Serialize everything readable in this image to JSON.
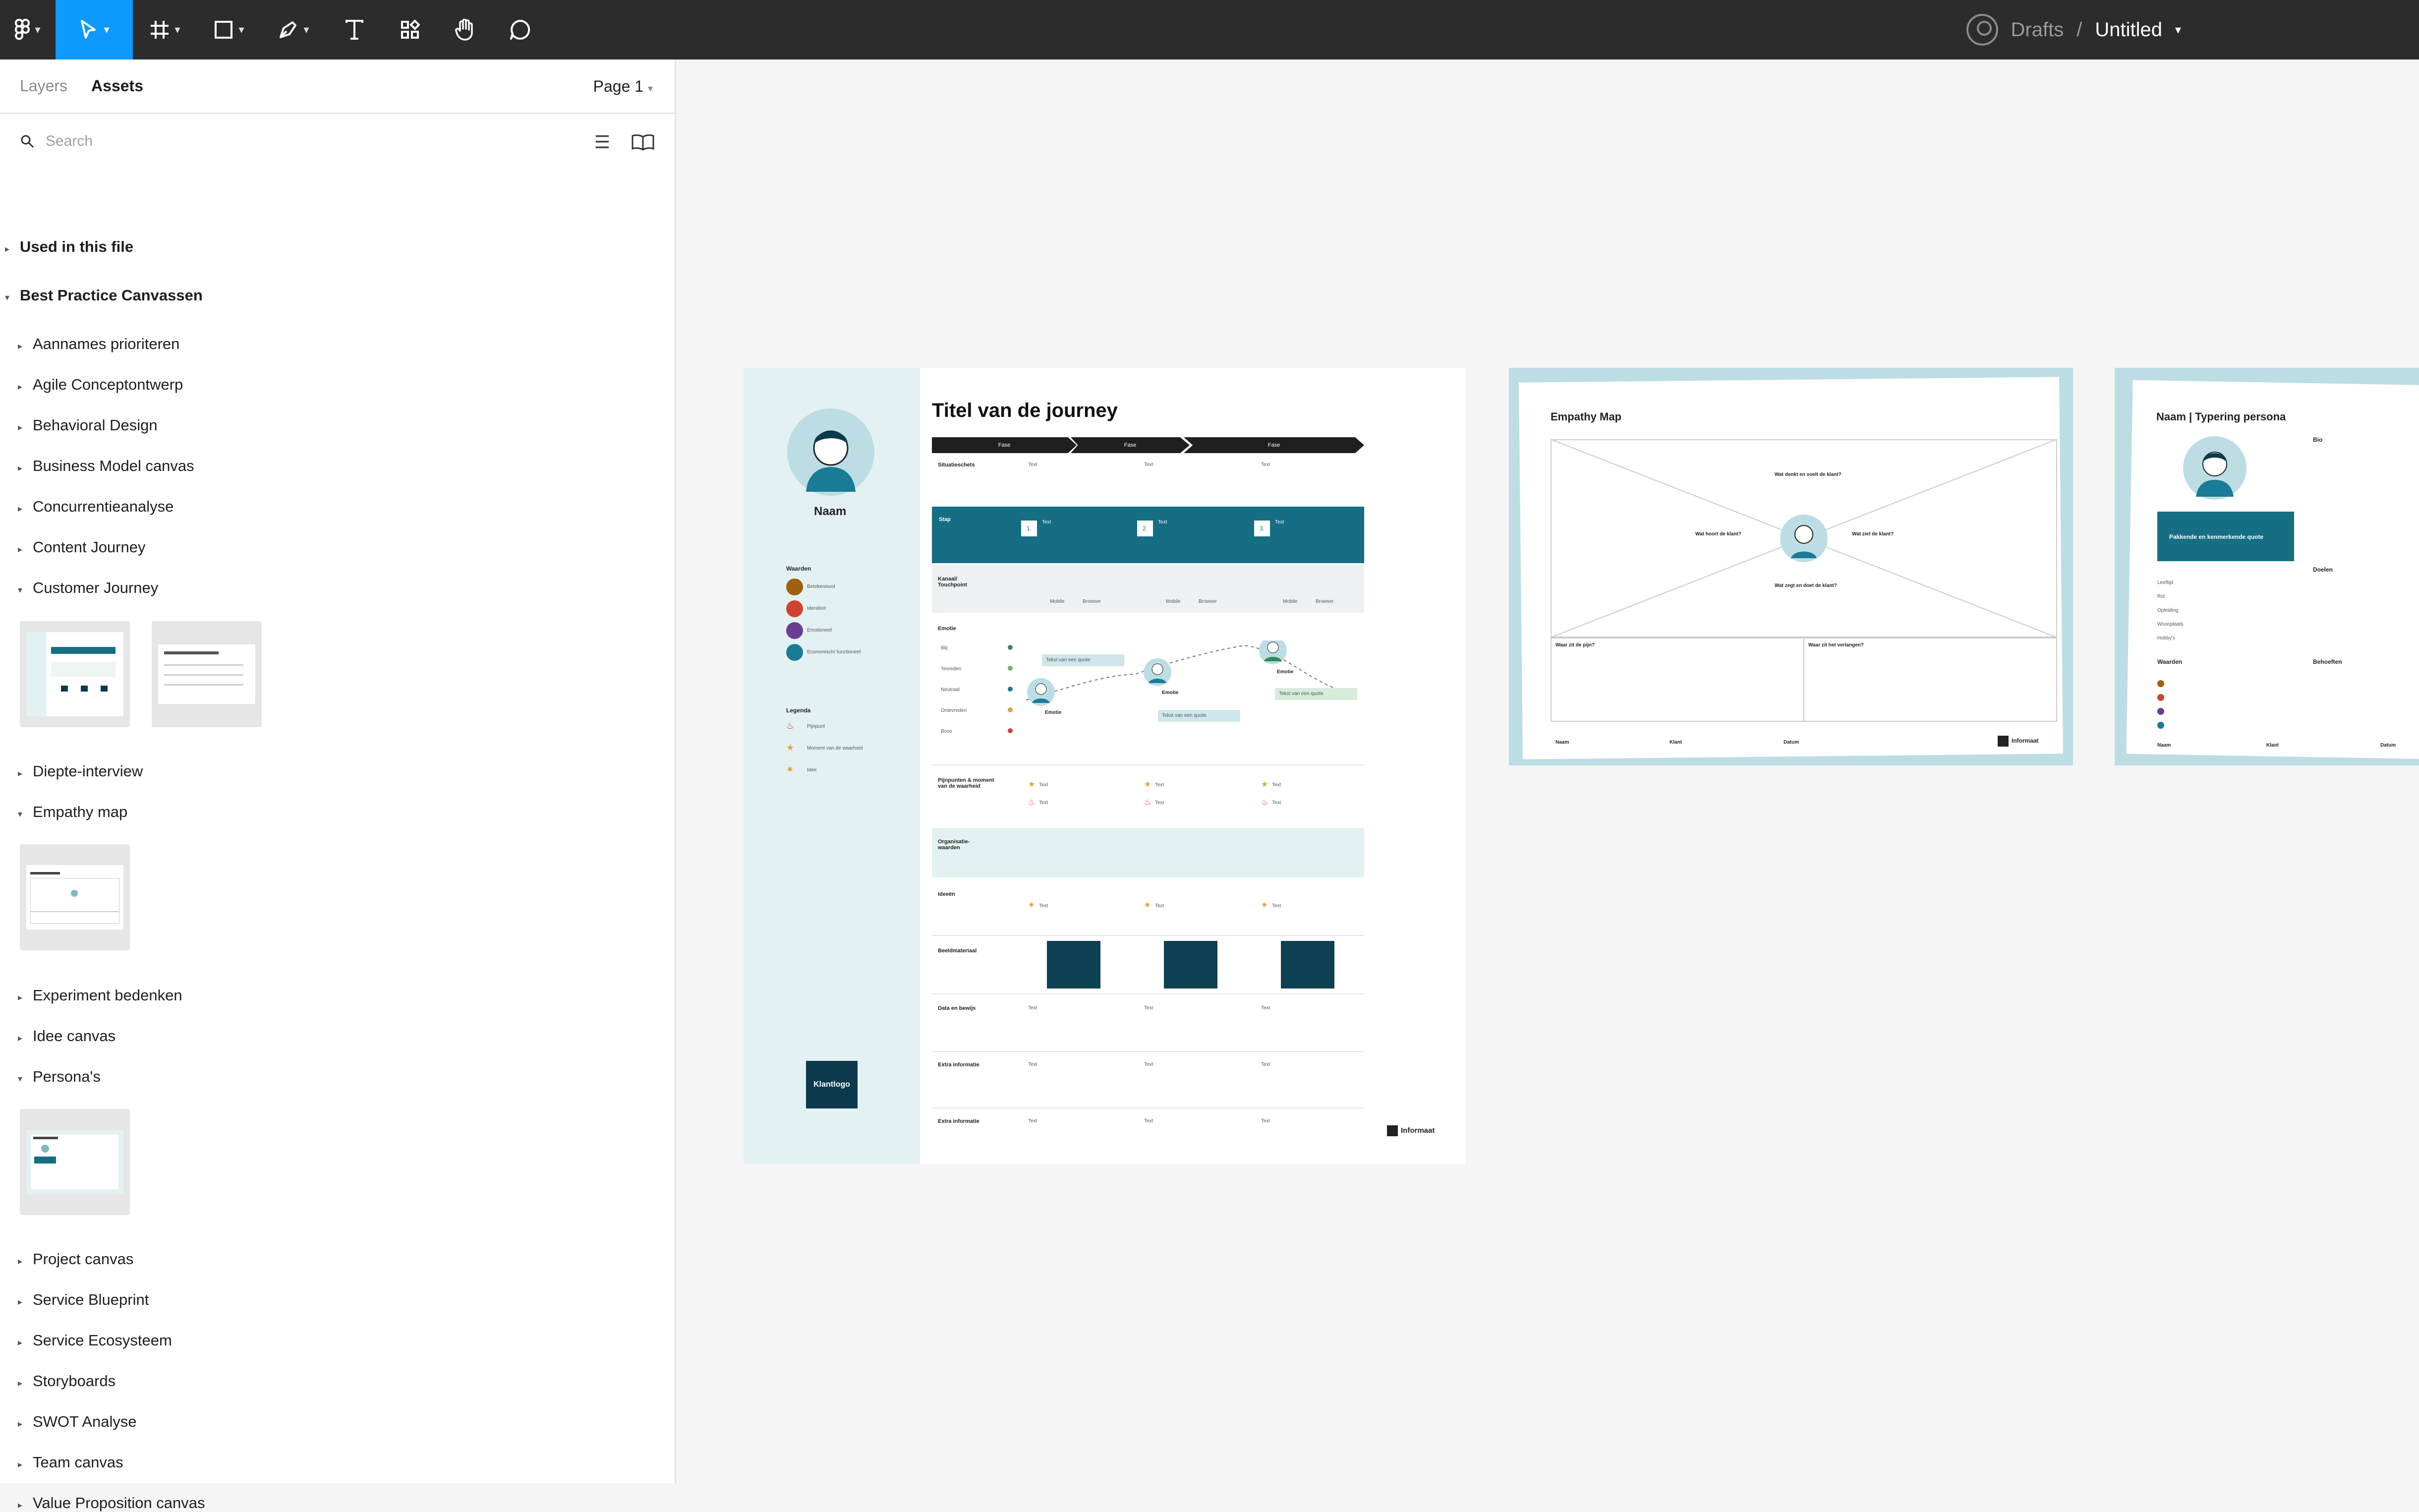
{
  "toolbar": {
    "breadcrumb_parent": "Drafts",
    "separator": "/",
    "file_title": "Untitled",
    "icons": [
      "figma-menu-icon",
      "move-tool-icon",
      "frame-tool-icon",
      "shape-tool-icon",
      "pen-tool-icon",
      "text-tool-icon",
      "resources-icon",
      "hand-tool-icon",
      "comment-tool-icon"
    ]
  },
  "sidebar": {
    "tabs": [
      "Layers",
      "Assets"
    ],
    "page_selector": "Page 1",
    "search_placeholder": "Search",
    "used_in_file": "Used in this file",
    "library_title": "Best Practice Canvassen",
    "items": [
      "Aannames prioriteren",
      "Agile Conceptontwerp",
      "Behavioral Design",
      "Business Model canvas",
      "Concurrentieanalyse",
      "Content Journey",
      "Customer Journey",
      "Diepte-interview",
      "Empathy map",
      "Experiment bedenken",
      "Idee canvas",
      "Persona's",
      "Project canvas",
      "Service Blueprint",
      "Service Ecosysteem",
      "Storyboards",
      "SWOT Analyse",
      "Team canvas",
      "Value Proposition canvas"
    ]
  },
  "journey": {
    "title": "Titel van de journey",
    "persona_name": "Naam",
    "phases": [
      "Fase",
      "Fase",
      "Fase"
    ],
    "situation_label": "Situatieschets",
    "step_label": "Stap",
    "step_numbers": [
      "1.",
      "2.",
      "3."
    ],
    "channel_label": "Kanaal/ Touchpoint",
    "devices": [
      "Mobile",
      "Browser",
      "Mobile",
      "Browser",
      "Mobile",
      "Browser"
    ],
    "emotion_label": "Emotie",
    "emotion_scale": [
      "Blij",
      "Tevreden",
      "Neutraal",
      "Ontevreden",
      "Boos"
    ],
    "emotion_point_label": "Emotie",
    "quote_label": "Tekst van een quote",
    "pains_label": "Pijnpunten & moment van de waarheid",
    "org_values_label": "Organisatie-waarden",
    "ideas_label": "Ideeën",
    "images_label": "Beeldmateriaal",
    "data_label": "Data en bewijs",
    "extra_label_1": "Extra informatie",
    "extra_label_2": "Extra informatie",
    "cell_text": "Text",
    "values_title": "Waarden",
    "values": [
      "Betekenisvol",
      "Identiteit",
      "Emotioneel",
      "Economisch/ functioneel"
    ],
    "legend_title": "Legenda",
    "legend": [
      "Pijnpunt",
      "Moment van de waarheid",
      "Idee"
    ],
    "client_logo": "Klantlogo",
    "brand": "Informaat"
  },
  "empathy": {
    "title": "Empathy Map",
    "q_think": "Wat denkt en voelt de klant?",
    "q_hear": "Wat hoort de klant?",
    "q_see": "Wat ziet de klant?",
    "q_say": "Wat zegt en doet de klant?",
    "q_pain": "Waar zit de pijn?",
    "q_gain": "Waar zit het verlangen?",
    "footer": [
      "Naam",
      "Klant",
      "Datum"
    ],
    "brand": "Informaat"
  },
  "persona": {
    "title": "Naam | Typering persona",
    "bio": "Bio",
    "quote": "Pakkende en kenmerkende quote",
    "fields": [
      "Leeftijd",
      "Rol",
      "Opleiding",
      "Woonplaats",
      "Hobby's"
    ],
    "goals": "Doelen",
    "values": "Waarden",
    "needs": "Behoeften",
    "footer": [
      "Naam",
      "Klant",
      "Datum"
    ]
  },
  "colors": {
    "accent": "#0d99ff",
    "journey_teal": "#156e84",
    "journey_light": "#e3f1f2",
    "dark_navy": "#0c3a4d",
    "value_colors": [
      "#a0600f",
      "#d0432e",
      "#6b3d93",
      "#1a7b96"
    ]
  }
}
